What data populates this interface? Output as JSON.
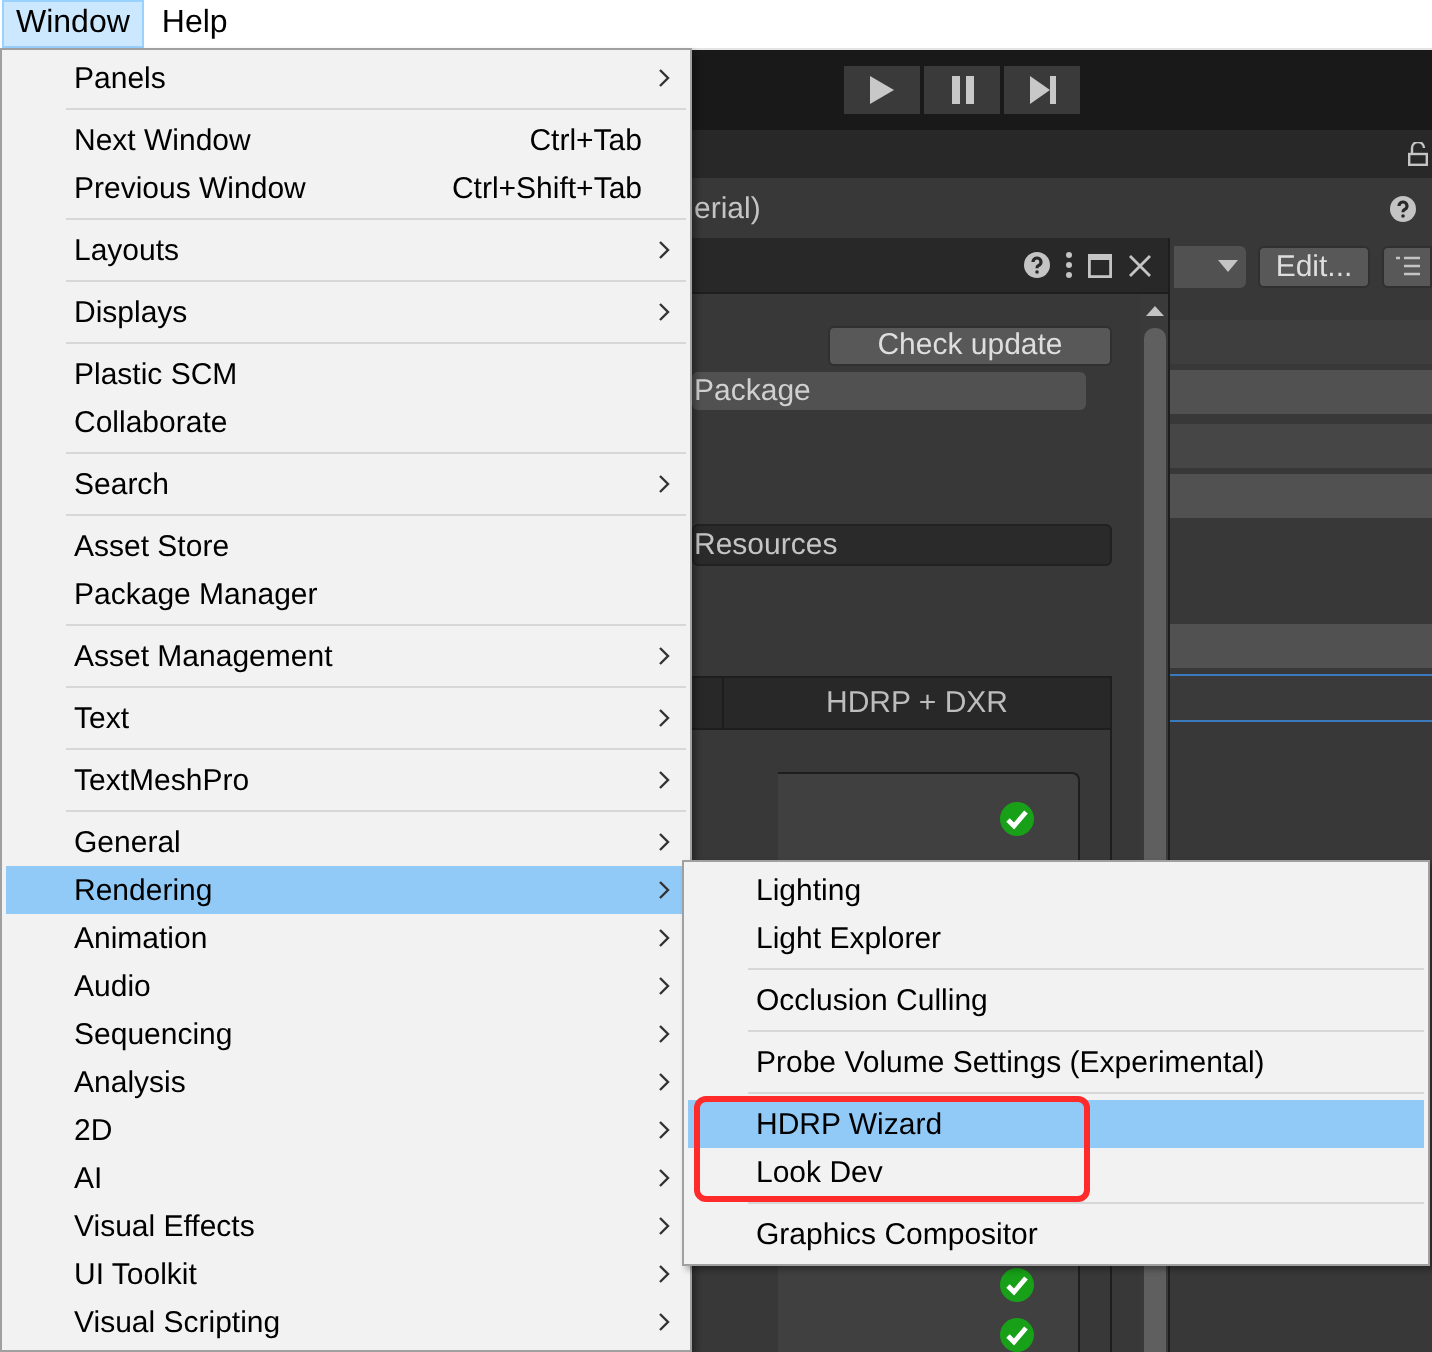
{
  "menu_bar": [
    {
      "label": "Window",
      "selected": true
    },
    {
      "label": "Help",
      "selected": false
    }
  ],
  "window_menu": {
    "groups": [
      [
        {
          "label": "Panels",
          "submenu": true,
          "selected": false
        }
      ],
      [
        {
          "label": "Next Window",
          "shortcut": "Ctrl+Tab",
          "submenu": false,
          "selected": false
        },
        {
          "label": "Previous Window",
          "shortcut": "Ctrl+Shift+Tab",
          "submenu": false,
          "selected": false
        }
      ],
      [
        {
          "label": "Layouts",
          "submenu": true,
          "selected": false
        }
      ],
      [
        {
          "label": "Displays",
          "submenu": true,
          "selected": false
        }
      ],
      [
        {
          "label": "Plastic SCM",
          "submenu": false,
          "selected": false
        },
        {
          "label": "Collaborate",
          "submenu": false,
          "selected": false
        }
      ],
      [
        {
          "label": "Search",
          "submenu": true,
          "selected": false
        }
      ],
      [
        {
          "label": "Asset Store",
          "submenu": false,
          "selected": false
        },
        {
          "label": "Package Manager",
          "submenu": false,
          "selected": false
        }
      ],
      [
        {
          "label": "Asset Management",
          "submenu": true,
          "selected": false
        }
      ],
      [
        {
          "label": "Text",
          "submenu": true,
          "selected": false
        }
      ],
      [
        {
          "label": "TextMeshPro",
          "submenu": true,
          "selected": false
        }
      ],
      [
        {
          "label": "General",
          "submenu": true,
          "selected": false
        },
        {
          "label": "Rendering",
          "submenu": true,
          "selected": true
        },
        {
          "label": "Animation",
          "submenu": true,
          "selected": false
        },
        {
          "label": "Audio",
          "submenu": true,
          "selected": false
        },
        {
          "label": "Sequencing",
          "submenu": true,
          "selected": false
        },
        {
          "label": "Analysis",
          "submenu": true,
          "selected": false
        },
        {
          "label": "2D",
          "submenu": true,
          "selected": false
        },
        {
          "label": "AI",
          "submenu": true,
          "selected": false
        },
        {
          "label": "Visual Effects",
          "submenu": true,
          "selected": false
        },
        {
          "label": "UI Toolkit",
          "submenu": true,
          "selected": false
        },
        {
          "label": "Visual Scripting",
          "submenu": true,
          "selected": false
        }
      ]
    ]
  },
  "rendering_submenu": {
    "groups": [
      [
        {
          "label": "Lighting",
          "selected": false
        },
        {
          "label": "Light Explorer",
          "selected": false
        }
      ],
      [
        {
          "label": "Occlusion Culling",
          "selected": false
        }
      ],
      [
        {
          "label": "Probe Volume Settings (Experimental)",
          "selected": false
        }
      ],
      [
        {
          "label": "HDRP Wizard",
          "selected": true
        },
        {
          "label": "Look Dev",
          "selected": false
        }
      ],
      [
        {
          "label": "Graphics Compositor",
          "selected": false
        }
      ]
    ]
  },
  "editor": {
    "inspector_title": "erial)",
    "edit_button": "Edit...",
    "wizard": {
      "check_update_button": "Check update",
      "package_field": "Package",
      "resources_field": "Resources",
      "table_header": "HDRP + DXR"
    }
  }
}
